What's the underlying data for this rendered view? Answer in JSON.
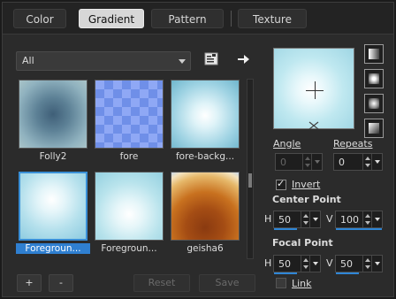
{
  "tabs": [
    {
      "label": "Color",
      "active": false
    },
    {
      "label": "Gradient",
      "active": true
    },
    {
      "label": "Pattern",
      "active": false
    },
    {
      "label": "Texture",
      "active": false
    }
  ],
  "preset_filter": {
    "selected": "All"
  },
  "icons": {
    "save_preset": "save-preset-icon",
    "export": "arrow-right-icon"
  },
  "swatches": [
    {
      "name": "Folly2",
      "selected": false
    },
    {
      "name": "fore",
      "selected": false
    },
    {
      "name": "fore-backg...",
      "selected": false
    },
    {
      "name": "Foregroun...",
      "selected": true
    },
    {
      "name": "Foregroun...",
      "selected": false
    },
    {
      "name": "geisha6",
      "selected": false
    }
  ],
  "buttons": {
    "add": "+",
    "remove": "-",
    "reset": "Reset",
    "save": "Save"
  },
  "angle": {
    "label": "Angle",
    "value": "0"
  },
  "repeats": {
    "label": "Repeats",
    "value": "0"
  },
  "invert": {
    "label": "Invert",
    "checked": true
  },
  "center_point": {
    "label": "Center Point",
    "h_label": "H",
    "h_value": "50",
    "v_label": "V",
    "v_value": "100"
  },
  "focal_point": {
    "label": "Focal Point",
    "h_label": "H",
    "h_value": "50",
    "v_label": "V",
    "v_value": "50"
  },
  "link": {
    "label": "Link",
    "checked": false
  },
  "colors": {
    "accent": "#2f86d6",
    "selection": "#2f7fd0"
  }
}
